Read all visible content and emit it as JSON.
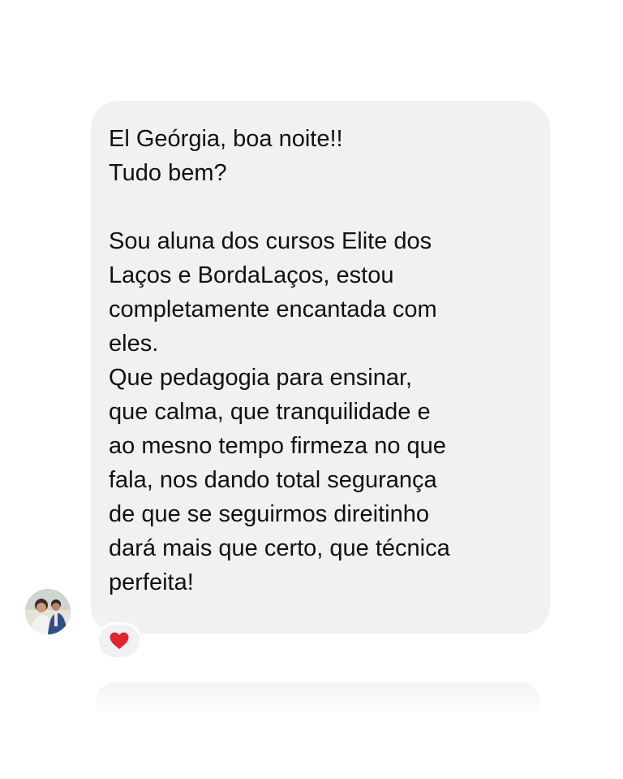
{
  "message": {
    "lines": [
      "El Geórgia, boa noite!!",
      "Tudo bem?",
      "",
      "Sou aluna dos cursos Elite dos",
      "Laços e BordaLaços, estou",
      "completamente encantada com",
      "eles.",
      "Que pedagogia para ensinar,",
      "que calma, que tranquilidade e",
      "ao mesno tempo firmeza no que",
      "fala, nos dando total segurança",
      "de que se seguirmos direitinho",
      "dará mais que certo, que técnica",
      "perfeita!"
    ]
  },
  "reaction": {
    "icon": "heart-icon",
    "color": "#e0252e"
  },
  "colors": {
    "bubble_background": "#f1f1f4",
    "text": "#111111",
    "page_background": "#ffffff"
  }
}
